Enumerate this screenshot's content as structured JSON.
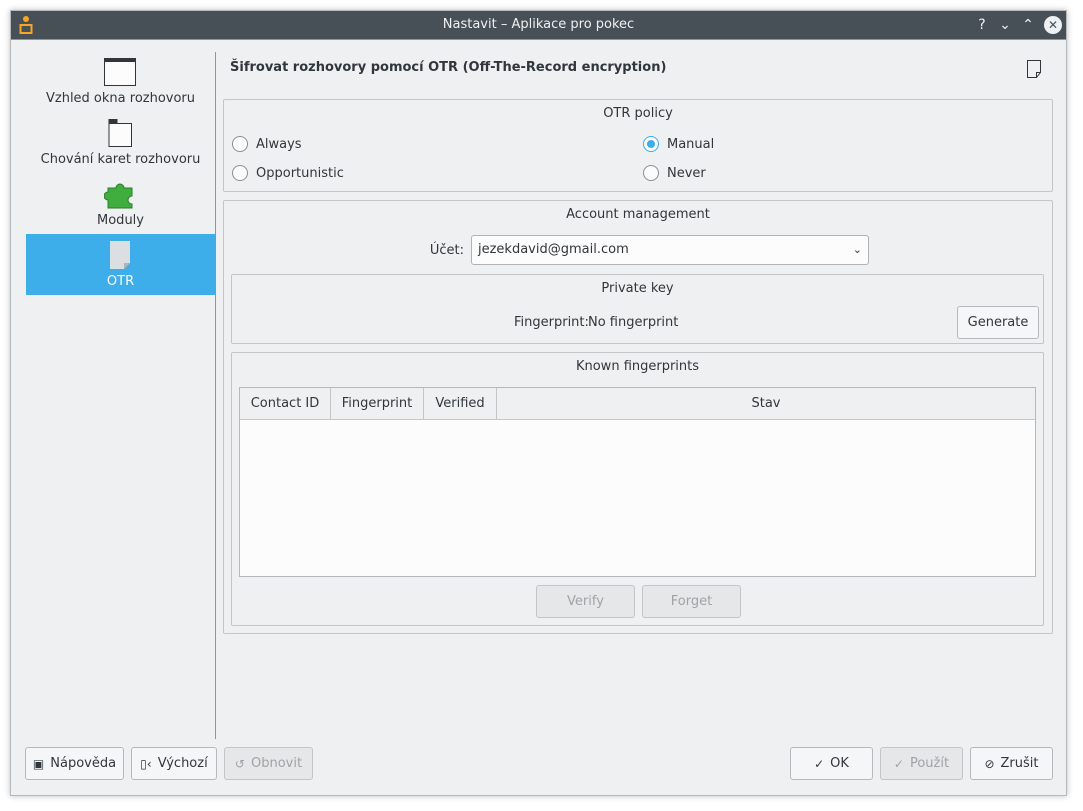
{
  "window": {
    "title": "Nastavit – Aplikace pro pokec",
    "titlebar_buttons": {
      "help": "?",
      "minimize": "⌄",
      "maximize": "⌃",
      "close": "✕"
    }
  },
  "sidebar": {
    "items": [
      {
        "label": "Vzhled okna rozhovoru",
        "icon": "window-icon"
      },
      {
        "label": "Chování karet rozhovoru",
        "icon": "tab-icon"
      },
      {
        "label": "Moduly",
        "icon": "puzzle-plugin-icon"
      },
      {
        "label": "OTR",
        "icon": "document-icon",
        "selected": true
      }
    ]
  },
  "page": {
    "title": "Šifrovat rozhovory pomocí OTR (Off-The-Record encryption)"
  },
  "otr_policy": {
    "title": "OTR policy",
    "options": [
      {
        "label": "Always",
        "checked": false
      },
      {
        "label": "Manual",
        "checked": true
      },
      {
        "label": "Opportunistic",
        "checked": false
      },
      {
        "label": "Never",
        "checked": false
      }
    ]
  },
  "account": {
    "title": "Account management",
    "label": "Účet:",
    "value": "jezekdavid@gmail.com"
  },
  "private_key": {
    "title": "Private key",
    "fingerprint_label": "Fingerprint:",
    "fingerprint_value": "No fingerprint",
    "generate_label": "Generate"
  },
  "known_fingerprints": {
    "title": "Known fingerprints",
    "columns": [
      "Contact ID",
      "Fingerprint",
      "Verified",
      "Stav"
    ],
    "rows": [],
    "verify_label": "Verify",
    "forget_label": "Forget"
  },
  "footer": {
    "help_label": "Nápověda",
    "defaults_label": "Výchozí",
    "reset_label": "Obnovit",
    "ok_label": "OK",
    "apply_label": "Použít",
    "cancel_label": "Zrušit"
  },
  "colors": {
    "accent": "#3daee9",
    "titlebar": "#475057",
    "window_bg": "#eff0f1"
  }
}
